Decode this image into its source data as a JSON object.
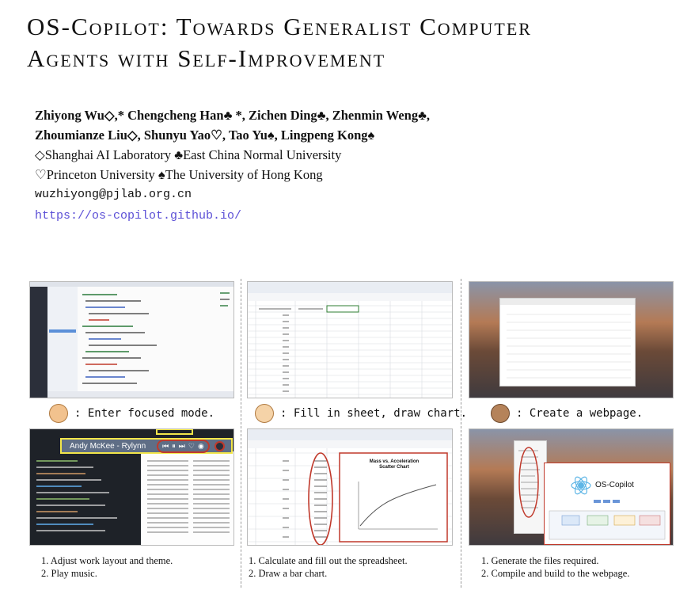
{
  "paper": {
    "title_line1": "OS-Copilot:  Towards Generalist Computer",
    "title_line2": "Agents with Self-Improvement",
    "authors_line1": "Zhiyong Wu◇,* Chengcheng Han♣ *, Zichen Ding♣, Zhenmin Weng♣,",
    "authors_line2": "Zhoumianze Liu◇, Shunyu Yao♡, Tao Yu♠, Lingpeng Kong♠",
    "affil_line1": "◇Shanghai AI Laboratory ♣East China Normal University",
    "affil_line2": "♡Princeton University ♠The University of Hong Kong",
    "email": "wuzhiyong@pjlab.org.cn",
    "url": "https://os-copilot.github.io/"
  },
  "figure": {
    "captions": [
      ": Enter focused mode.",
      ": Fill in sheet, draw chart.",
      ": Create a webpage."
    ],
    "music_bar_text": "Andy McKee - Rylynn",
    "chart_title": "Mass vs. Acceleration Scatter Chart",
    "webpage_title": "OS-Copilot",
    "steps": [
      [
        "1. Adjust work layout and theme.",
        "2. Play music."
      ],
      [
        "1. Calculate and fill out the spreadsheet.",
        "2. Draw a bar chart."
      ],
      [
        "1. Generate the files required.",
        "2. Compile and build to the webpage."
      ]
    ],
    "colors": {
      "highlight_yellow": "#f2e64a",
      "annotation_red": "#c0392b",
      "link_purple": "#5b4fd6"
    }
  }
}
